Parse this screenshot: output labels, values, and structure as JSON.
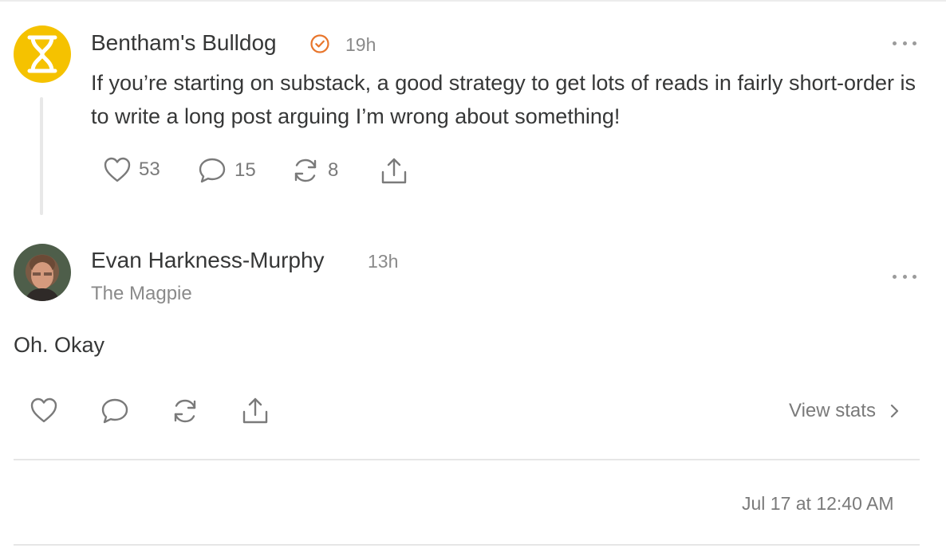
{
  "post": {
    "author": "Bentham's Bulldog",
    "verified_icon": "verified-check-icon",
    "time": "19h",
    "text": "If you’re starting on substack, a good strategy to get lots of reads in fairly short-order is to write a long post arguing I’m wrong about something!",
    "likes": "53",
    "comments": "15",
    "restacks": "8",
    "avatar_color": "#f5c200",
    "accent_color": "#e8762c"
  },
  "reply": {
    "author": "Evan Harkness-Murphy",
    "time": "13h",
    "publication": "The Magpie",
    "text": "Oh. Okay",
    "view_stats_label": "View stats"
  },
  "footer": {
    "date": "Jul 17 at 12:40 AM"
  }
}
